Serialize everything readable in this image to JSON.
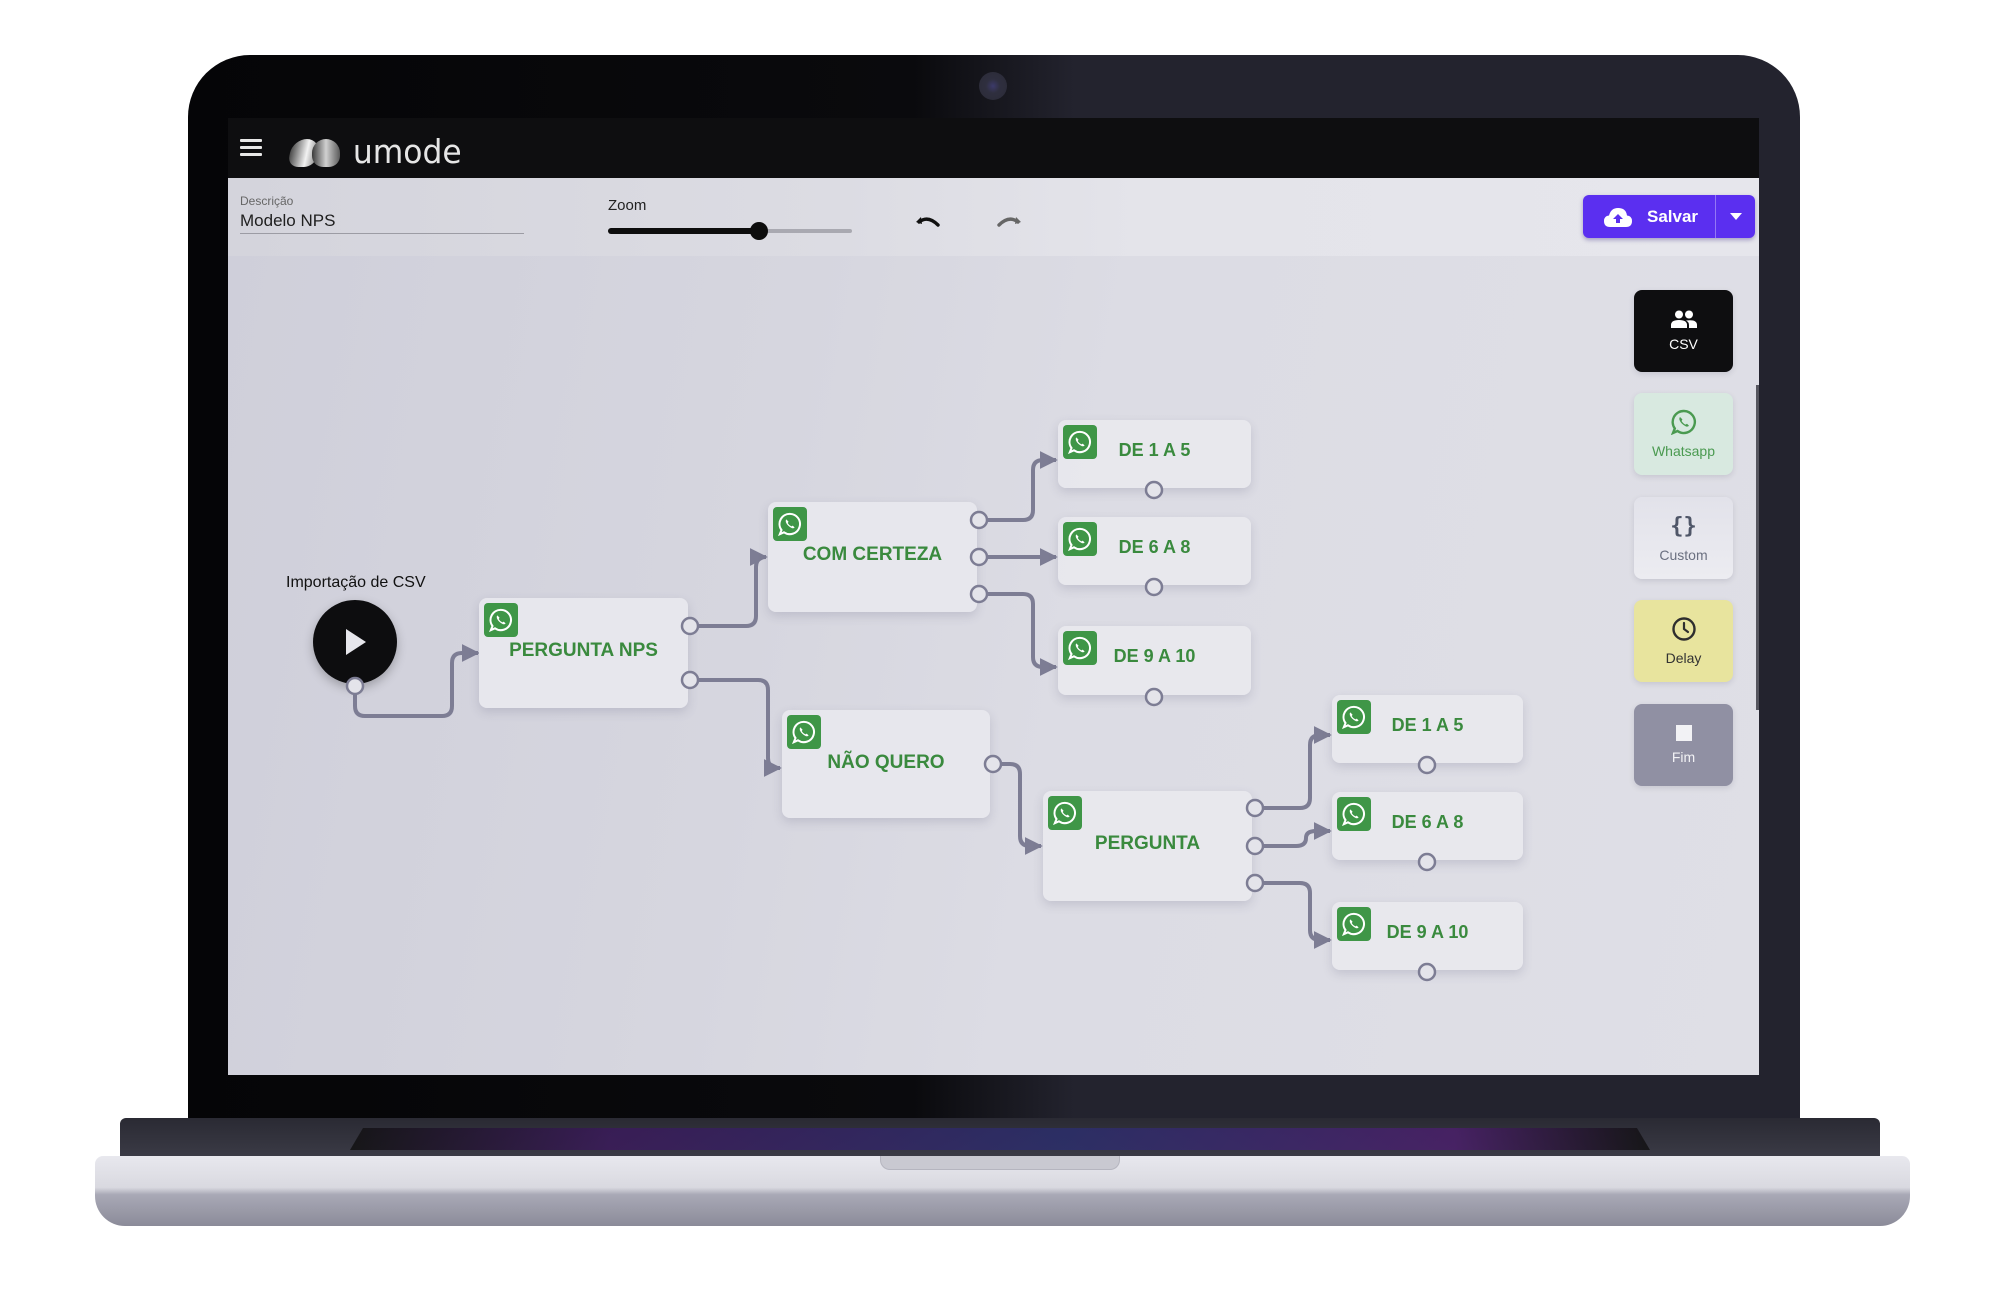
{
  "app": {
    "name": "umode",
    "menu_icon": "hamburger-menu-icon"
  },
  "toolbar": {
    "description_label": "Descrição",
    "description_value": "Modelo NPS",
    "zoom_label": "Zoom",
    "zoom_value_percent": 62,
    "undo_icon": "undo-icon",
    "redo_icon": "redo-icon",
    "save_label": "Salvar",
    "save_icon": "cloud-upload-icon",
    "save_dropdown_icon": "caret-down-icon",
    "accent_color": "#5b2ff0"
  },
  "flow": {
    "start": {
      "label": "Importação de CSV",
      "icon": "play-icon"
    },
    "nodes": [
      {
        "id": "pergunta-nps",
        "title": "PERGUNTA NPS",
        "type": "whatsapp"
      },
      {
        "id": "com-certeza",
        "title": "COM CERTEZA",
        "type": "whatsapp"
      },
      {
        "id": "nao-quero",
        "title": "NÃO QUERO",
        "type": "whatsapp"
      },
      {
        "id": "a-de-1-a-5",
        "title": "DE 1 A 5",
        "type": "whatsapp"
      },
      {
        "id": "a-de-6-a-8",
        "title": "DE 6 A 8",
        "type": "whatsapp"
      },
      {
        "id": "a-de-9-a-10",
        "title": "DE 9 A 10",
        "type": "whatsapp"
      },
      {
        "id": "pergunta",
        "title": "PERGUNTA",
        "type": "whatsapp"
      },
      {
        "id": "b-de-1-a-5",
        "title": "DE 1 A 5",
        "type": "whatsapp"
      },
      {
        "id": "b-de-6-a-8",
        "title": "DE 6 A 8",
        "type": "whatsapp"
      },
      {
        "id": "b-de-9-a-10",
        "title": "DE 9 A 10",
        "type": "whatsapp"
      }
    ],
    "edges": [
      [
        "start",
        "pergunta-nps"
      ],
      [
        "pergunta-nps",
        "com-certeza"
      ],
      [
        "pergunta-nps",
        "nao-quero"
      ],
      [
        "com-certeza",
        "a-de-1-a-5"
      ],
      [
        "com-certeza",
        "a-de-6-a-8"
      ],
      [
        "com-certeza",
        "a-de-9-a-10"
      ],
      [
        "nao-quero",
        "pergunta"
      ],
      [
        "pergunta",
        "b-de-1-a-5"
      ],
      [
        "pergunta",
        "b-de-6-a-8"
      ],
      [
        "pergunta",
        "b-de-9-a-10"
      ]
    ],
    "node_text_color": "#3a8a3e",
    "whatsapp_color": "#3f9647"
  },
  "palette": [
    {
      "label": "CSV",
      "icon": "users-icon"
    },
    {
      "label": "Whatsapp",
      "icon": "whatsapp-icon"
    },
    {
      "label": "Custom",
      "icon": "braces-icon"
    },
    {
      "label": "Delay",
      "icon": "clock-icon"
    },
    {
      "label": "Fim",
      "icon": "stop-square-icon"
    }
  ]
}
